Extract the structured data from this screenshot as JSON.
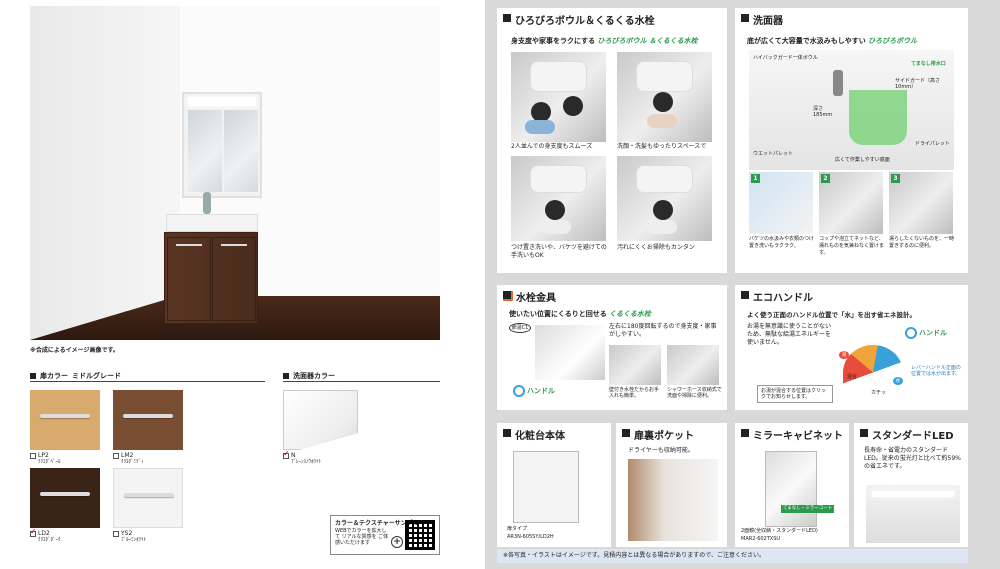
{
  "left": {
    "caption": "※合成によるイメージ画像です。",
    "door_color": {
      "section_title": "扉カラー",
      "grade": "ミドルグレード",
      "swatches": [
        {
          "code": "LP2",
          "name": "ｸﾘｴﾀﾞﾍﾟｰﾙ",
          "color": "#d9aa6e",
          "checked": false
        },
        {
          "code": "LM2",
          "name": "ｸﾘｴﾀﾞﾐﾃﾞｨ",
          "color": "#7a4e33",
          "checked": false
        },
        {
          "code": "LD2",
          "name": "ｸﾘｴﾀﾞﾀﾞｰｸ",
          "color": "#3a2418",
          "checked": true
        },
        {
          "code": "YS2",
          "name": "ﾌﾞﾙｰﾐﾝﾎﾜｲﾄ",
          "color": "#f4f4f4",
          "checked": false
        }
      ]
    },
    "basin_color": {
      "section_title": "洗面器カラー",
      "code": "N",
      "name": "ﾌﾟﾚｰﾝｽﾉｳﾎﾜｲﾄ",
      "checked": true
    },
    "sample": {
      "title": "カラー＆テクスチャーサンプル",
      "desc": "WEBでカラーを拡大して リアルな質感を ご体感いただけます"
    }
  },
  "cards": {
    "bowl": {
      "title": "ひろびろボウル＆くるくる水栓",
      "lead": "身支度や家事をラクにする",
      "lead_brand": "ひろびろボウル ＆くるくる水栓",
      "captions": [
        "2人並んでの身支度もスムーズ",
        "洗顔・洗髪もゆったりスペースで",
        "つけ置き洗いや、バケツを避けての手洗いもOK",
        "汚れにくくお掃除もカンタン"
      ]
    },
    "basin": {
      "title": "洗面器",
      "lead": "底が広くて大容量で水汲みもしやすい",
      "lead_brand": "ひろびろボウル",
      "labels": {
        "guard": "ハイバックガード一体ボウル",
        "side": "サイドガード（高さ10mm）",
        "depth": "深さ185mm",
        "wet": "ウエットパレット",
        "dry": "ドライパレット",
        "wide": "広くて作業しやすい底面",
        "tenaru": "てまなし排水口"
      },
      "steps": [
        {
          "n": "1",
          "text": "バケツの水汲みや衣類のつけ置き洗いもラクラク。"
        },
        {
          "n": "2",
          "text": "コップや泡立てネットなど、濡れものを気兼ねなく置けます。"
        },
        {
          "n": "3",
          "text": "濡らしたくないものを、一時置きするのに便利。"
        }
      ],
      "step_labels": [
        "1",
        "2",
        "3"
      ]
    },
    "faucet": {
      "title": "水栓金具",
      "lead": "使いたい位置にくるりと回せる",
      "lead_brand": "くるくる水栓",
      "eco_mark": "節湯C1",
      "desc": "左右に180度回転するので身支度・家事がしやすい。",
      "cap1": "壁付き水栓だからお手入れも簡単。",
      "cap2": "シャワーホース収納式で洗面や掃除に便利。",
      "handle": "ハンドル"
    },
    "eco": {
      "title": "エコハンドル",
      "lead": "よく使う正面のハンドル位置で「水」を出す省エネ設計。",
      "desc": "お湯を無意識に使うことがないため、無駄な給湯エネルギーを使いません。",
      "note": "お湯が混合する位置はクリックでお知らせします。",
      "lever": "レバーハンドル正面の位置では水が出ます。",
      "labels": [
        "湯",
        "混合",
        "水",
        "カチッ"
      ],
      "handle": "ハンドル"
    },
    "body": {
      "title": "化粧台本体",
      "type": "扉タイプ",
      "model": "AR3N-605SY/LD2H"
    },
    "pocket": {
      "title": "扉裏ポケット",
      "desc": "ドライヤーも収納可能。"
    },
    "mirror": {
      "title": "ミラーキャビネット",
      "desc": "2面鏡(全収納・スタンダードLED)",
      "model": "MAR2-602TXSU",
      "tag": "てまなし・ミラーコート"
    },
    "led": {
      "title": "スタンダードLED",
      "desc": "長寿命・省電力のスタンダードLED。従来の蛍光灯と比べて約59%の省エネです。"
    }
  },
  "footer": "※各写真・イラストはイメージです。見積内容とは異なる場合がありますので、ご注意ください。"
}
